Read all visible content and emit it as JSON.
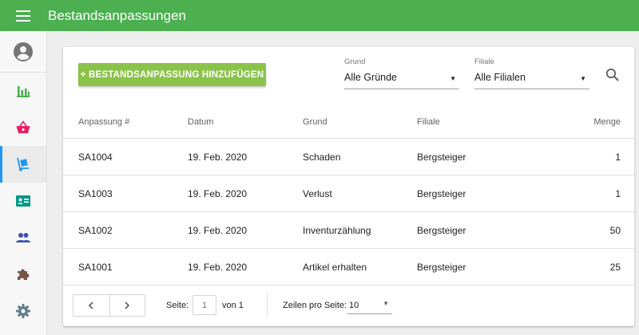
{
  "app": {
    "title": "Bestandsanpassungen"
  },
  "sidebar": {
    "items": [
      {
        "name": "reports",
        "icon": "bar-chart-icon",
        "color": "#4caf50"
      },
      {
        "name": "sales",
        "icon": "basket-icon",
        "color": "#e91e63"
      },
      {
        "name": "inventory",
        "icon": "hand-truck-icon",
        "color": "#2196f3",
        "active": true
      },
      {
        "name": "customers",
        "icon": "contact-card-icon",
        "color": "#009688"
      },
      {
        "name": "employees",
        "icon": "people-icon",
        "color": "#3f51b5"
      },
      {
        "name": "apps",
        "icon": "puzzle-icon",
        "color": "#795548"
      },
      {
        "name": "settings",
        "icon": "gear-icon",
        "color": "#607d8b"
      }
    ]
  },
  "toolbar": {
    "add_label": "+ BESTANDSANPASSUNG HINZUFÜGEN",
    "grund": {
      "label": "Grund",
      "value": "Alle Gründe"
    },
    "filiale": {
      "label": "Filiale",
      "value": "Alle Filialen"
    }
  },
  "table": {
    "headers": [
      "Anpassung #",
      "Datum",
      "Grund",
      "Filiale",
      "Menge"
    ],
    "rows": [
      [
        "SA1004",
        "19. Feb. 2020",
        "Schaden",
        "Bergsteiger",
        "1"
      ],
      [
        "SA1003",
        "19. Feb. 2020",
        "Verlust",
        "Bergsteiger",
        "1"
      ],
      [
        "SA1002",
        "19. Feb. 2020",
        "Inventurzählung",
        "Bergsteiger",
        "50"
      ],
      [
        "SA1001",
        "19. Feb. 2020",
        "Artikel erhalten",
        "Bergsteiger",
        "25"
      ]
    ]
  },
  "pagination": {
    "page_label": "Seite:",
    "page_value": "1",
    "of_label": "von 1",
    "rows_label": "Zeilen pro Seite:",
    "rows_value": "10"
  },
  "colors": {
    "appbar": "#4caf50",
    "add_button": "#8bc34a",
    "active_indicator": "#2196f3"
  }
}
